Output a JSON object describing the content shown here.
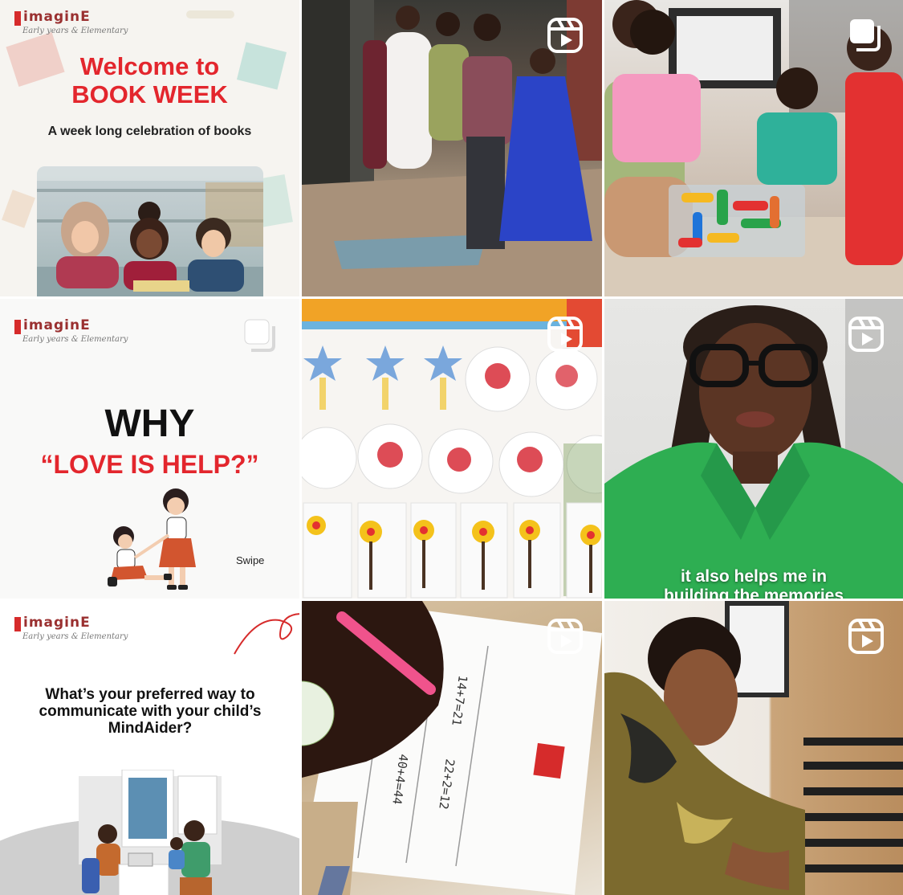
{
  "brand": {
    "wordmark": "imaginE",
    "tagline": "Early years & Elementary"
  },
  "colors": {
    "brand_red": "#e3262d",
    "text_dark": "#111111",
    "badge_white": "#ffffff"
  },
  "posts": [
    {
      "id": 1,
      "kind": "carousel-graphic",
      "badge_icon": "none",
      "title_line1": "Welcome to",
      "title_line2": "BOOK WEEK",
      "subtitle": "A week long celebration of books",
      "photo_subject": "children reading a book in a library"
    },
    {
      "id": 2,
      "kind": "reel",
      "badge_icon": "reels-icon",
      "photo_subject": "children in party clothes walking in a line outdoors"
    },
    {
      "id": 3,
      "kind": "carousel",
      "badge_icon": "carousel-icon",
      "photo_subject": "children playing with a tub of colorful building blocks"
    },
    {
      "id": 4,
      "kind": "carousel-graphic",
      "badge_icon": "carousel-icon",
      "title_line1": "WHY",
      "title_line2": "“LOVE IS HELP?”",
      "swipe": "Swipe",
      "illustration": "girl helping another girl stand up"
    },
    {
      "id": 5,
      "kind": "reel",
      "badge_icon": "reels-icon",
      "photo_subject": "classroom wall with star puppets, handprint plates and flower paintings"
    },
    {
      "id": 6,
      "kind": "reel",
      "badge_icon": "reels-icon",
      "caption_line1": "it also helps me in",
      "caption_line2": "building the memories",
      "photo_subject": "woman with glasses and braids in a green shirt speaking"
    },
    {
      "id": 7,
      "kind": "graphic",
      "badge_icon": "none",
      "question": "What’s your preferred way to communicate with your child’s MindAider?",
      "illustration": "parent and child meeting a teacher at a desk"
    },
    {
      "id": 8,
      "kind": "reel",
      "badge_icon": "reels-icon",
      "photo_subject": "child solving a maths worksheet with a pink pencil"
    },
    {
      "id": 9,
      "kind": "reel",
      "badge_icon": "reels-icon",
      "photo_subject": "woman in patterned top leaning over a wooden table"
    }
  ]
}
